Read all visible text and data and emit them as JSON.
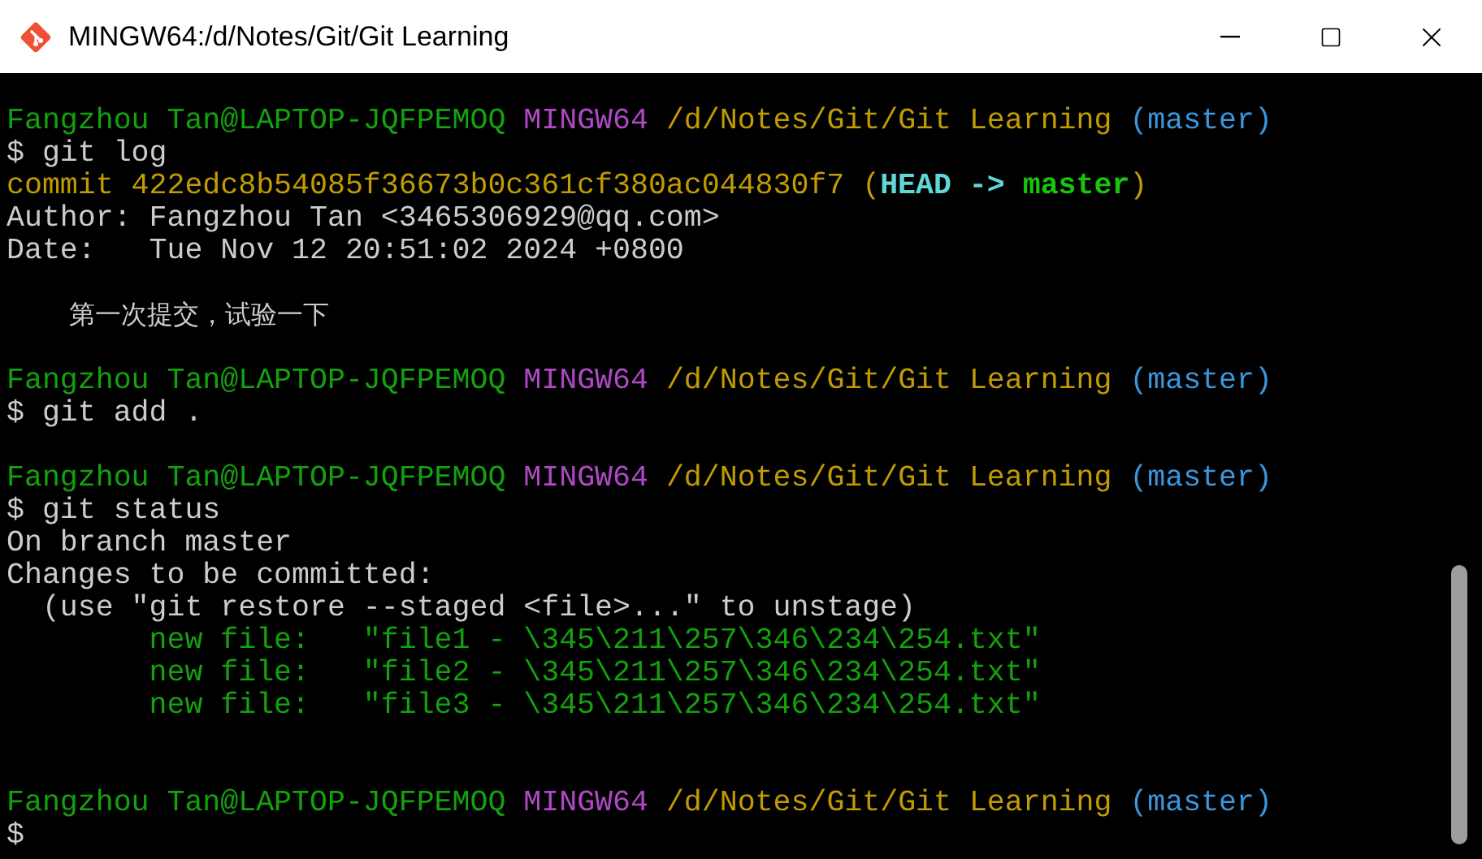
{
  "window": {
    "title": "MINGW64:/d/Notes/Git/Git Learning"
  },
  "terminal": {
    "lines": [
      {
        "kind": "blank"
      },
      {
        "kind": "text",
        "segments": [
          {
            "kind": "user",
            "text": "Fangzhou Tan@LAPTOP-JQFPEMOQ"
          },
          {
            "kind": "system",
            "text": "MINGW64"
          },
          {
            "kind": "path",
            "text": "/d/Notes/Git/Git Learning"
          },
          {
            "kind": "branch",
            "text": "(master)"
          }
        ]
      },
      {
        "kind": "text",
        "segments": [
          {
            "kind": "plain",
            "text": "$ git log"
          }
        ]
      },
      {
        "kind": "text",
        "segments": [
          {
            "kind": "commit",
            "text": "commit 422edc8b54085f36673b0c361cf380ac044830f7 ("
          },
          {
            "kind": "head",
            "text": "HEAD ->"
          },
          {
            "kind": "ref",
            "text": "master"
          },
          {
            "kind": "commit_end",
            "text": ")"
          }
        ]
      },
      {
        "kind": "text",
        "segments": [
          {
            "kind": "plain",
            "text": "Author: Fangzhou Tan <3465306929@qq.com>"
          }
        ]
      },
      {
        "kind": "text",
        "segments": [
          {
            "kind": "plain",
            "text": "Date:   Tue Nov 12 20:51:02 2024 +0800"
          }
        ]
      },
      {
        "kind": "blank"
      },
      {
        "kind": "text",
        "segments": [
          {
            "kind": "message",
            "text": "    第一次提交，试验一下"
          }
        ]
      },
      {
        "kind": "blank"
      },
      {
        "kind": "text",
        "segments": [
          {
            "kind": "user",
            "text": "Fangzhou Tan@LAPTOP-JQFPEMOQ"
          },
          {
            "kind": "system",
            "text": "MINGW64"
          },
          {
            "kind": "path",
            "text": "/d/Notes/Git/Git Learning"
          },
          {
            "kind": "branch",
            "text": "(master)"
          }
        ]
      },
      {
        "kind": "text",
        "segments": [
          {
            "kind": "plain",
            "text": "$ git add ."
          }
        ]
      },
      {
        "kind": "blank"
      },
      {
        "kind": "text",
        "segments": [
          {
            "kind": "user",
            "text": "Fangzhou Tan@LAPTOP-JQFPEMOQ"
          },
          {
            "kind": "system",
            "text": "MINGW64"
          },
          {
            "kind": "path",
            "text": "/d/Notes/Git/Git Learning"
          },
          {
            "kind": "branch",
            "text": "(master)"
          }
        ]
      },
      {
        "kind": "text",
        "segments": [
          {
            "kind": "plain",
            "text": "$ git status"
          }
        ]
      },
      {
        "kind": "text",
        "segments": [
          {
            "kind": "plain",
            "text": "On branch master"
          }
        ]
      },
      {
        "kind": "text",
        "segments": [
          {
            "kind": "plain",
            "text": "Changes to be committed:"
          }
        ]
      },
      {
        "kind": "text",
        "segments": [
          {
            "kind": "plain",
            "text": "  (use \"git restore --staged <file>...\" to unstage)"
          }
        ]
      },
      {
        "kind": "text",
        "segments": [
          {
            "kind": "added",
            "text": "        new file:   \"file1 - \\345\\211\\257\\346\\234\\254.txt\""
          }
        ]
      },
      {
        "kind": "text",
        "segments": [
          {
            "kind": "added",
            "text": "        new file:   \"file2 - \\345\\211\\257\\346\\234\\254.txt\""
          }
        ]
      },
      {
        "kind": "text",
        "segments": [
          {
            "kind": "added",
            "text": "        new file:   \"file3 - \\345\\211\\257\\346\\234\\254.txt\""
          }
        ]
      },
      {
        "kind": "blank"
      },
      {
        "kind": "blank"
      },
      {
        "kind": "text",
        "segments": [
          {
            "kind": "user",
            "text": "Fangzhou Tan@LAPTOP-JQFPEMOQ"
          },
          {
            "kind": "system",
            "text": "MINGW64"
          },
          {
            "kind": "path",
            "text": "/d/Notes/Git/Git Learning"
          },
          {
            "kind": "branch",
            "text": "(master)"
          }
        ]
      },
      {
        "kind": "text",
        "segments": [
          {
            "kind": "plain",
            "text": "$"
          }
        ]
      }
    ]
  }
}
